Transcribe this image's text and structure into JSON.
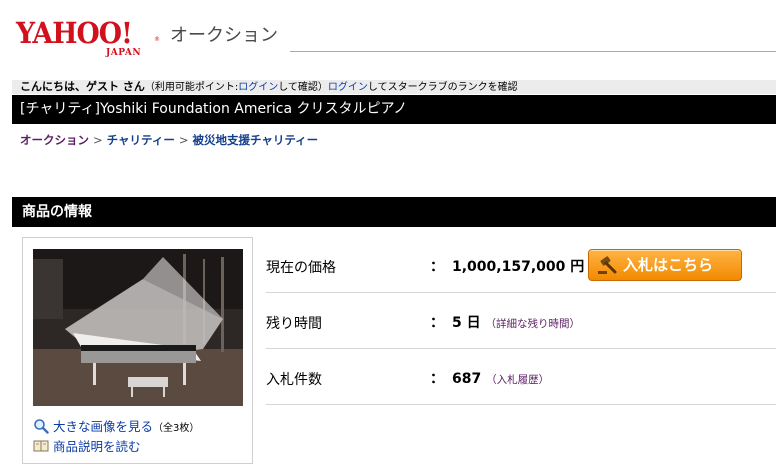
{
  "header": {
    "logo_text": "YAHOO!",
    "logo_sub": "JAPAN",
    "service_name": "オークション"
  },
  "welcome": {
    "greeting": "こんにちは、ゲスト さん",
    "points_prefix": "（利用可能ポイント:",
    "login_link_1": "ログイン",
    "points_suffix": "して確認）",
    "login_link_2": "ログイン",
    "rank_suffix": "してスタークラブのランクを確認"
  },
  "title": "[チャリティ]Yoshiki Foundation America クリスタルピアノ",
  "breadcrumb": {
    "items": [
      "オークション",
      "チャリティー",
      "被災地支援チャリティー"
    ],
    "separator": ">"
  },
  "section_title": "商品の情報",
  "image_panel": {
    "photo_alt": "crystal-grand-piano-photo",
    "enlarge_link": "大きな画像を見る",
    "enlarge_count": "（全3枚）",
    "description_link": "商品説明を読む"
  },
  "info": {
    "price_label": "現在の価格",
    "price_colon": "：",
    "price_value": "1,000,157,000 円",
    "bid_button": "入札はこちら",
    "time_label": "残り時間",
    "time_colon": "：",
    "time_value": "5 日",
    "time_detail": "（詳細な残り時間）",
    "bids_label": "入札件数",
    "bids_colon": "：",
    "bids_value": "687",
    "bids_history": "（入札履歴）"
  },
  "colors": {
    "logo_red": "#d2111f",
    "bar_black": "#000000",
    "link_blue": "#0b3ca4",
    "link_purple": "#5b1e62",
    "bid_orange": "#f28a00"
  },
  "icons": [
    "magnifier-icon",
    "book-icon",
    "gavel-icon"
  ]
}
